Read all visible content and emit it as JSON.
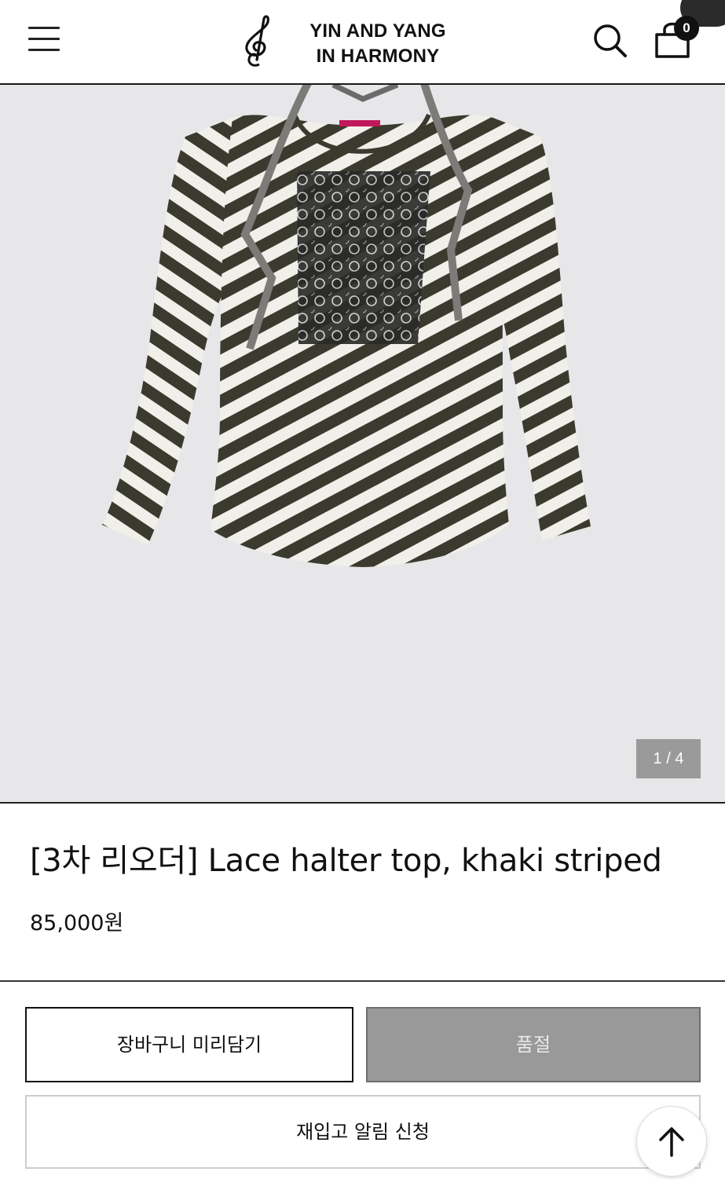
{
  "header": {
    "brand_line1": "YIN AND YANG",
    "brand_line2": "IN HARMONY",
    "cart_count": "0",
    "icons": [
      "menu-icon",
      "treble-clef-logo",
      "search-icon",
      "shopping-bag-icon"
    ]
  },
  "gallery": {
    "counter": "1 / 4",
    "image": "khaki striped long-sleeve top with lace halter straps and lace front panel"
  },
  "product": {
    "title": "[3차 리오더] Lace halter top, khaki striped",
    "price": "85,000원"
  },
  "actions": {
    "cart_label": "장바구니 미리담기",
    "soldout_label": "품절",
    "restock_label": "재입고 알림 신청",
    "scroll_top_icon": "arrow-up-icon"
  },
  "colors": {
    "accent_dark": "#111111",
    "soldout_bg": "#999999",
    "gallery_bg": "#e7e7e9",
    "stripe_khaki": "#3b3a2e"
  }
}
